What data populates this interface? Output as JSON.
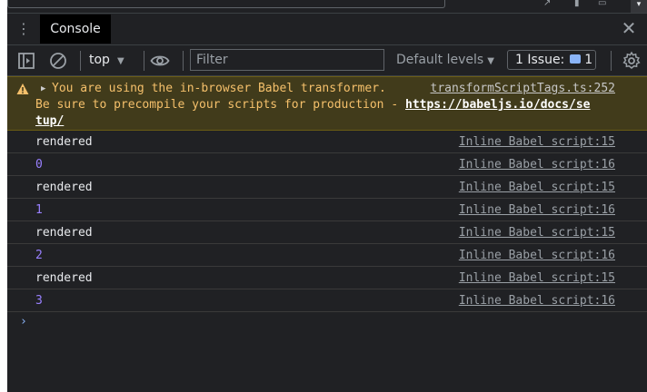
{
  "tabbar": {
    "menu_icon": "more-vert-icon",
    "tab_label": "Console",
    "close_icon": "close-icon"
  },
  "toolbar": {
    "context": "top",
    "filter_placeholder": "Filter",
    "levels_label": "Default levels",
    "issues_label": "1 Issue:",
    "issues_count": "1"
  },
  "warning": {
    "line1": "You are using the in-browser Babel transformer.",
    "source": "transformScriptTags.ts:252",
    "line2": "Be sure to precompile your scripts for production - ",
    "link_part1": "https://babeljs.io/docs/se",
    "link_part2": "tup/"
  },
  "logs": [
    {
      "message": "rendered",
      "source": "Inline Babel script:15",
      "kind": "text"
    },
    {
      "message": "0",
      "source": "Inline Babel script:16",
      "kind": "num"
    },
    {
      "message": "rendered",
      "source": "Inline Babel script:15",
      "kind": "text"
    },
    {
      "message": "1",
      "source": "Inline Babel script:16",
      "kind": "num"
    },
    {
      "message": "rendered",
      "source": "Inline Babel script:15",
      "kind": "text"
    },
    {
      "message": "2",
      "source": "Inline Babel script:16",
      "kind": "num"
    },
    {
      "message": "rendered",
      "source": "Inline Babel script:15",
      "kind": "text"
    },
    {
      "message": "3",
      "source": "Inline Babel script:16",
      "kind": "num"
    }
  ],
  "colors": {
    "warning_text": "#f5c06b",
    "number": "#9980ff",
    "accent": "#8ab4f8"
  }
}
